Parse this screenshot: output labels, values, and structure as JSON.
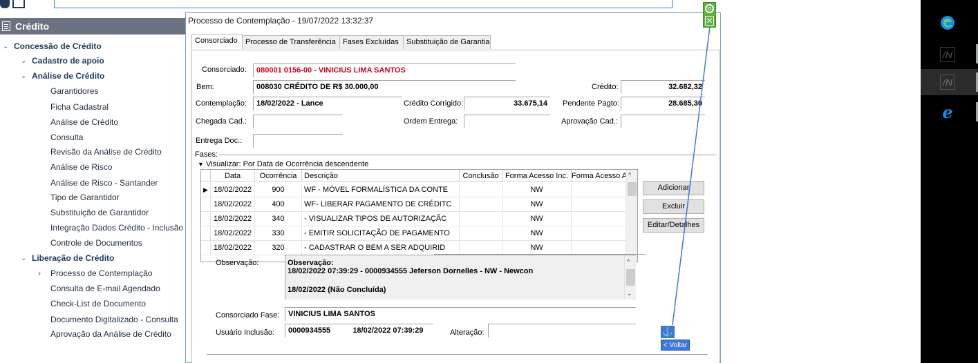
{
  "nav": {
    "header": "Crédito",
    "items": [
      {
        "label": "Concessão de Crédito",
        "bold": true,
        "expanded": true
      },
      {
        "label": "Cadastro de apoio",
        "bold": true,
        "expanded": true
      },
      {
        "label": "Análise de Crédito",
        "bold": true,
        "expanded": true
      },
      {
        "label": "Garantidores"
      },
      {
        "label": "Ficha Cadastral"
      },
      {
        "label": "Análise de Crédito"
      },
      {
        "label": "Consulta"
      },
      {
        "label": "Revisão da Análise de Crédito"
      },
      {
        "label": "Análise de Risco"
      },
      {
        "label": "Análise de Risco - Santander"
      },
      {
        "label": "Tipo de Garantidor"
      },
      {
        "label": "Substituição de Garantidor"
      },
      {
        "label": "Integração Dados Crédito - Inclusão"
      },
      {
        "label": "Controle de Documentos"
      },
      {
        "label": "Liberação de Crédito",
        "bold": true,
        "expanded": true
      },
      {
        "label": "Processo de Contemplação",
        "collapsed": true
      },
      {
        "label": "Consulta de E-mail Agendado"
      },
      {
        "label": "Check-List de Documento"
      },
      {
        "label": "Documento Digitalizado - Consulta"
      },
      {
        "label": "Aprovação da Análise de Crédito"
      }
    ]
  },
  "dialog": {
    "title": "Processo de Contemplação - 19/07/2022  13:32:37",
    "tabs": [
      "Consorciado",
      "Processo de Transferência",
      "Fases Excluídas",
      "Substituição de Garantia"
    ],
    "active_tab": "Consorciado",
    "form": {
      "consorciado_label": "Consorciado:",
      "consorciado_value": "080001 0156-00 - VINICIUS LIMA SANTOS",
      "bem_label": "Bem:",
      "bem_value": "008030   CRÉDITO DE R$ 30.000,00",
      "credito_label": "Crédito:",
      "credito_value": "32.682,32",
      "contemplacao_label": "Contemplação:",
      "contemplacao_value": "18/02/2022 - Lance",
      "credito_corrigido_label": "Crédito Corrigido:",
      "credito_corrigido_value": "33.675,14",
      "pendente_label": "Pendente Pagto:",
      "pendente_value": "28.685,30",
      "chegada_label": "Chegada Cad.:",
      "ordem_label": "Ordem Entrega:",
      "aprovacao_label": "Aprovação Cad.:",
      "entrega_label": "Entrega Doc.:"
    },
    "fases": {
      "label": "Fases:",
      "view_label": "Visualizar: Por Data de Ocorrência descendente",
      "columns": [
        "Data",
        "Ocorrência",
        "Descrição",
        "Conclusão",
        "Forma Acesso Inc.",
        "Forma Acesso Alt."
      ],
      "rows": [
        {
          "data": "18/02/2022",
          "ocorrencia": "900",
          "descricao": "WF - MÓVEL FORMALÍSTICA DA CONTE",
          "conclusao": "",
          "inc": "NW",
          "alt": "",
          "selected": true
        },
        {
          "data": "18/02/2022",
          "ocorrencia": "400",
          "descricao": "WF- LIBERAR PAGAMENTO DE CRÉDITC",
          "conclusao": "",
          "inc": "NW",
          "alt": ""
        },
        {
          "data": "18/02/2022",
          "ocorrencia": "340",
          "descricao": "- VISUALIZAR TIPOS DE AUTORIZAÇÃC",
          "conclusao": "",
          "inc": "NW",
          "alt": ""
        },
        {
          "data": "18/02/2022",
          "ocorrencia": "330",
          "descricao": "- EMITIR SOLICITAÇÃO DE PAGAMENTO",
          "conclusao": "",
          "inc": "NW",
          "alt": ""
        },
        {
          "data": "18/02/2022",
          "ocorrencia": "320",
          "descricao": "- CADASTRAR O BEM A SER ADQUIRID",
          "conclusao": "",
          "inc": "NW",
          "alt": ""
        }
      ]
    },
    "buttons": {
      "adicionar": "Adicionar",
      "excluir": "Excluir",
      "editar": "Editar/Detalhes"
    },
    "observacao": {
      "label": "Observação:",
      "line1": "Observação:",
      "line2": "18/02/2022 07:39:29 - 0000934555 Jeferson Dornelles - NW - Newcon",
      "line3": "18/02/2022 (Não Concluída)"
    },
    "consorciado_fase": {
      "label": "Consorciado Fase:",
      "value": "VINICIUS LIMA SANTOS"
    },
    "usuario_inclusao": {
      "label": "Usuário Inclusão:",
      "user": "0000934555",
      "datetime": "18/02/2022 07:39:29"
    },
    "alteracao": {
      "label": "Alteração:"
    }
  },
  "overlay": {
    "voltar": "< Voltar",
    "anchor_icon": "anchor-icon",
    "close_icon": "close-icon",
    "target_icon": "target-icon"
  },
  "taskbar": {
    "icons": [
      "edge-icon",
      "app-icon",
      "app-icon",
      "ie-icon"
    ]
  }
}
